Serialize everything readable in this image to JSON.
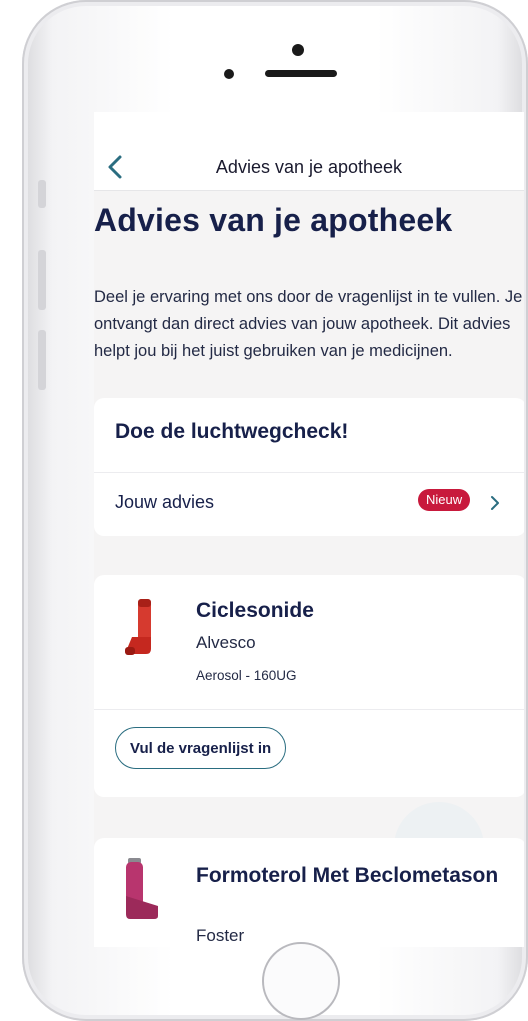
{
  "nav": {
    "title": "Advies van je apotheek",
    "back_icon": "chevron-left-icon"
  },
  "page": {
    "title": "Advies van je apotheek",
    "intro": "Deel je ervaring met ons door de vragenlijst in te vullen. Je ontvangt dan direct advies van jouw apotheek. Dit advies helpt jou bij het juist gebruiken van je medicijnen."
  },
  "check_card": {
    "title": "Doe de luchtwegcheck!",
    "row_label": "Jouw advies",
    "badge": "Nieuw",
    "badge_color": "#c8193c",
    "chevron_icon": "chevron-right-icon"
  },
  "medications": [
    {
      "name": "Ciclesonide",
      "brand": "Alvesco",
      "form": "Aerosol - 160UG",
      "icon": "inhaler-icon",
      "icon_color": "#d63a2f",
      "button_label": "Vul de vragenlijst in"
    },
    {
      "name": "Formoterol Met Beclometason",
      "brand": "Foster",
      "icon": "inhaler-icon",
      "icon_color": "#b8356e"
    }
  ],
  "colors": {
    "primary_text": "#17204a",
    "background": "#f5f4f4",
    "accent": "#2a6d80"
  }
}
